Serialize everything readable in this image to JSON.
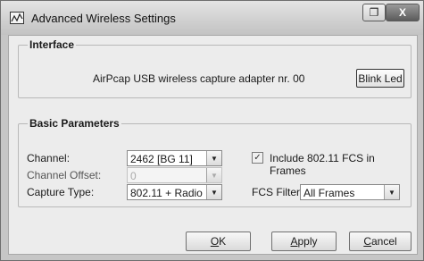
{
  "window": {
    "title": "Advanced Wireless Settings",
    "restore_label": "❐",
    "close_label": "X"
  },
  "interface": {
    "legend": "Interface",
    "adapter": "AirPcap USB wireless capture adapter nr. 00",
    "blink_label": "Blink Led"
  },
  "basic": {
    "legend": "Basic Parameters",
    "channel_label": "Channel:",
    "channel_value": "2462 [BG 11]",
    "offset_label": "Channel Offset:",
    "offset_value": "0",
    "capture_label": "Capture Type:",
    "capture_value": "802.11 + Radio",
    "fcs_include_label": "Include 802.11 FCS in Frames",
    "fcs_include_checked": true,
    "fcs_filter_label": "FCS Filter:",
    "fcs_filter_value": "All Frames"
  },
  "buttons": {
    "ok_mnemonic": "O",
    "ok_rest": "K",
    "apply_mnemonic": "A",
    "apply_rest": "pply",
    "cancel_mnemonic": "C",
    "cancel_rest": "ancel"
  }
}
